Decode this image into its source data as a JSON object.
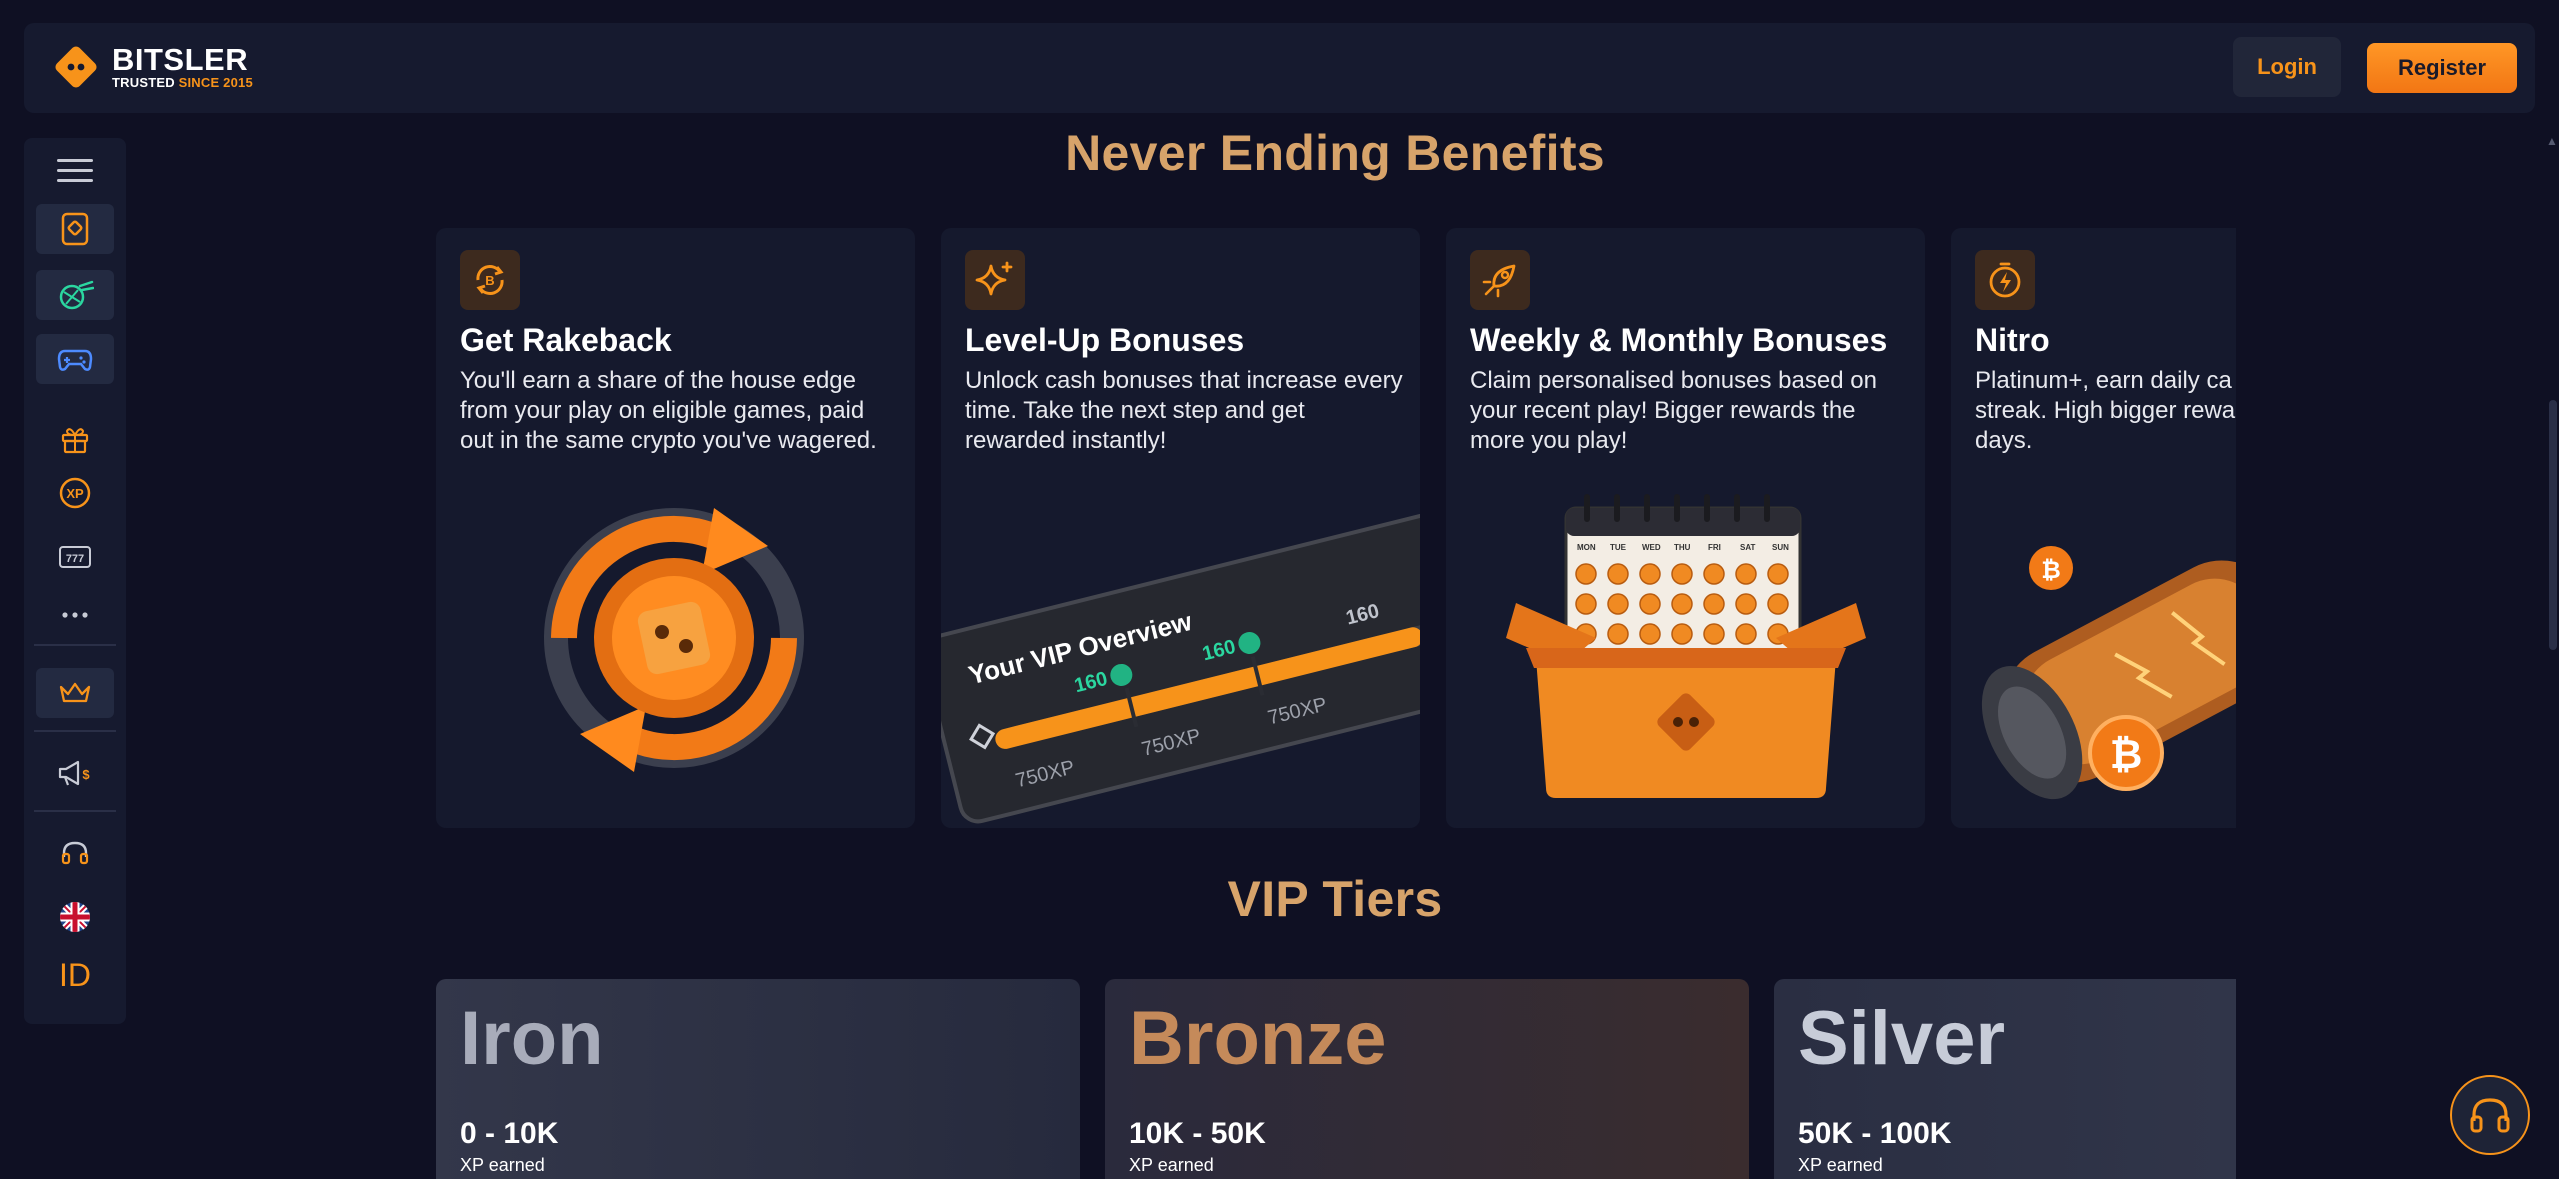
{
  "brand": {
    "name": "BITSLER",
    "tagline_prefix": "TRUSTED",
    "tagline_accent": "SINCE 2015"
  },
  "header": {
    "login_label": "Login",
    "register_label": "Register"
  },
  "sidebar": {
    "items": [
      {
        "name": "menu-icon",
        "active": false
      },
      {
        "name": "casino-icon",
        "active": true
      },
      {
        "name": "sports-icon",
        "active": true
      },
      {
        "name": "games-icon",
        "active": true
      },
      {
        "name": "gift-icon",
        "active": false
      },
      {
        "name": "xp-icon",
        "active": false
      },
      {
        "name": "slots-icon",
        "active": false
      },
      {
        "name": "more-icon",
        "active": false
      },
      {
        "name": "crown-icon",
        "active": true
      },
      {
        "name": "promotions-icon",
        "active": false
      },
      {
        "name": "support-icon",
        "active": false
      },
      {
        "name": "uk-flag-icon",
        "active": false
      }
    ],
    "id_label": "ID"
  },
  "benefits": {
    "title": "Never Ending Benefits",
    "cards": [
      {
        "icon": "rakeback-icon",
        "title": "Get Rakeback",
        "description": "You'll earn a share of the house edge from your play on eligible games, paid out in the same crypto you've wagered."
      },
      {
        "icon": "sparkle-icon",
        "title": "Level-Up Bonuses",
        "description": "Unlock cash bonuses that increase every time. Take the next step and get rewarded instantly!"
      },
      {
        "icon": "rocket-icon",
        "title": "Weekly & Monthly Bonuses",
        "description": "Claim personalised bonuses based on your recent play! Bigger rewards the more you play!"
      },
      {
        "icon": "nitro-icon",
        "title": "Nitro",
        "description": "Platinum+, earn daily ca on play and streak. High bigger rewards and mor days."
      }
    ],
    "vip_art": {
      "heading": "Your VIP Overview",
      "reward_1": "160",
      "reward_2": "160",
      "reward_3": "160",
      "xp_1": "750XP",
      "xp_2": "750XP",
      "xp_3": "750XP"
    },
    "calendar_days": [
      "MON",
      "TUE",
      "WED",
      "THU",
      "FRI",
      "SAT",
      "SUN"
    ]
  },
  "vip_tiers": {
    "title": "VIP Tiers",
    "tiers": [
      {
        "name": "Iron",
        "range": "0 - 10K",
        "sub": "XP earned",
        "color": "#a8acba"
      },
      {
        "name": "Bronze",
        "range": "10K - 50K",
        "sub": "XP earned",
        "color": "#c58a5a"
      },
      {
        "name": "Silver",
        "range": "50K - 100K",
        "sub": "XP earned",
        "color": "#c7ccd8"
      }
    ]
  },
  "colors": {
    "background": "#0f1023",
    "panel": "#161a2f",
    "accent": "#f7931a",
    "heading": "#d7a36a"
  }
}
